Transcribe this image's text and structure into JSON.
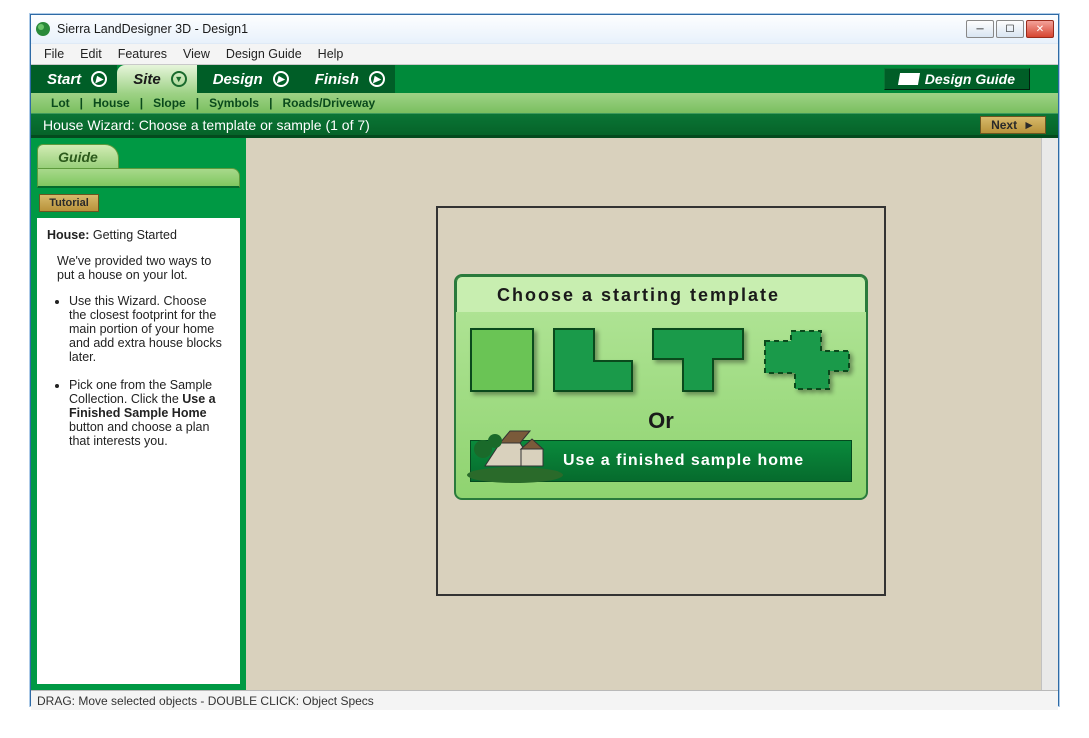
{
  "window": {
    "title": "Sierra LandDesigner 3D - Design1"
  },
  "menu": [
    "File",
    "Edit",
    "Features",
    "View",
    "Design Guide",
    "Help"
  ],
  "nav": {
    "tabs": [
      {
        "label": "Start",
        "active": false
      },
      {
        "label": "Site",
        "active": true
      },
      {
        "label": "Design",
        "active": false
      },
      {
        "label": "Finish",
        "active": false
      }
    ],
    "design_guide": "Design Guide"
  },
  "subnav": [
    "Lot",
    "House",
    "Slope",
    "Symbols",
    "Roads/Driveway"
  ],
  "wizard": {
    "title": "House Wizard: Choose a template or sample (1 of 7)",
    "next": "Next"
  },
  "sidebar": {
    "guide_tab": "Guide",
    "tutorial": "Tutorial",
    "heading_bold": "House:",
    "heading_rest": " Getting Started",
    "intro": "We've provided two ways to put a house on your lot.",
    "bullets": [
      {
        "pre": "Use this Wizard. Choose the closest footprint for the main portion of your home and add extra house blocks later."
      },
      {
        "pre": "Pick one from the Sample Collection. Click the ",
        "bold": "Use a Finished Sample Home",
        "post": " button and choose a plan that interests you."
      }
    ]
  },
  "template": {
    "header": "Choose a starting template",
    "or": "Or",
    "sample_btn": "Use a finished sample home",
    "shapes": [
      "square",
      "l-shape",
      "t-shape",
      "custom"
    ]
  },
  "status": "DRAG:  Move selected objects - DOUBLE CLICK: Object Specs"
}
